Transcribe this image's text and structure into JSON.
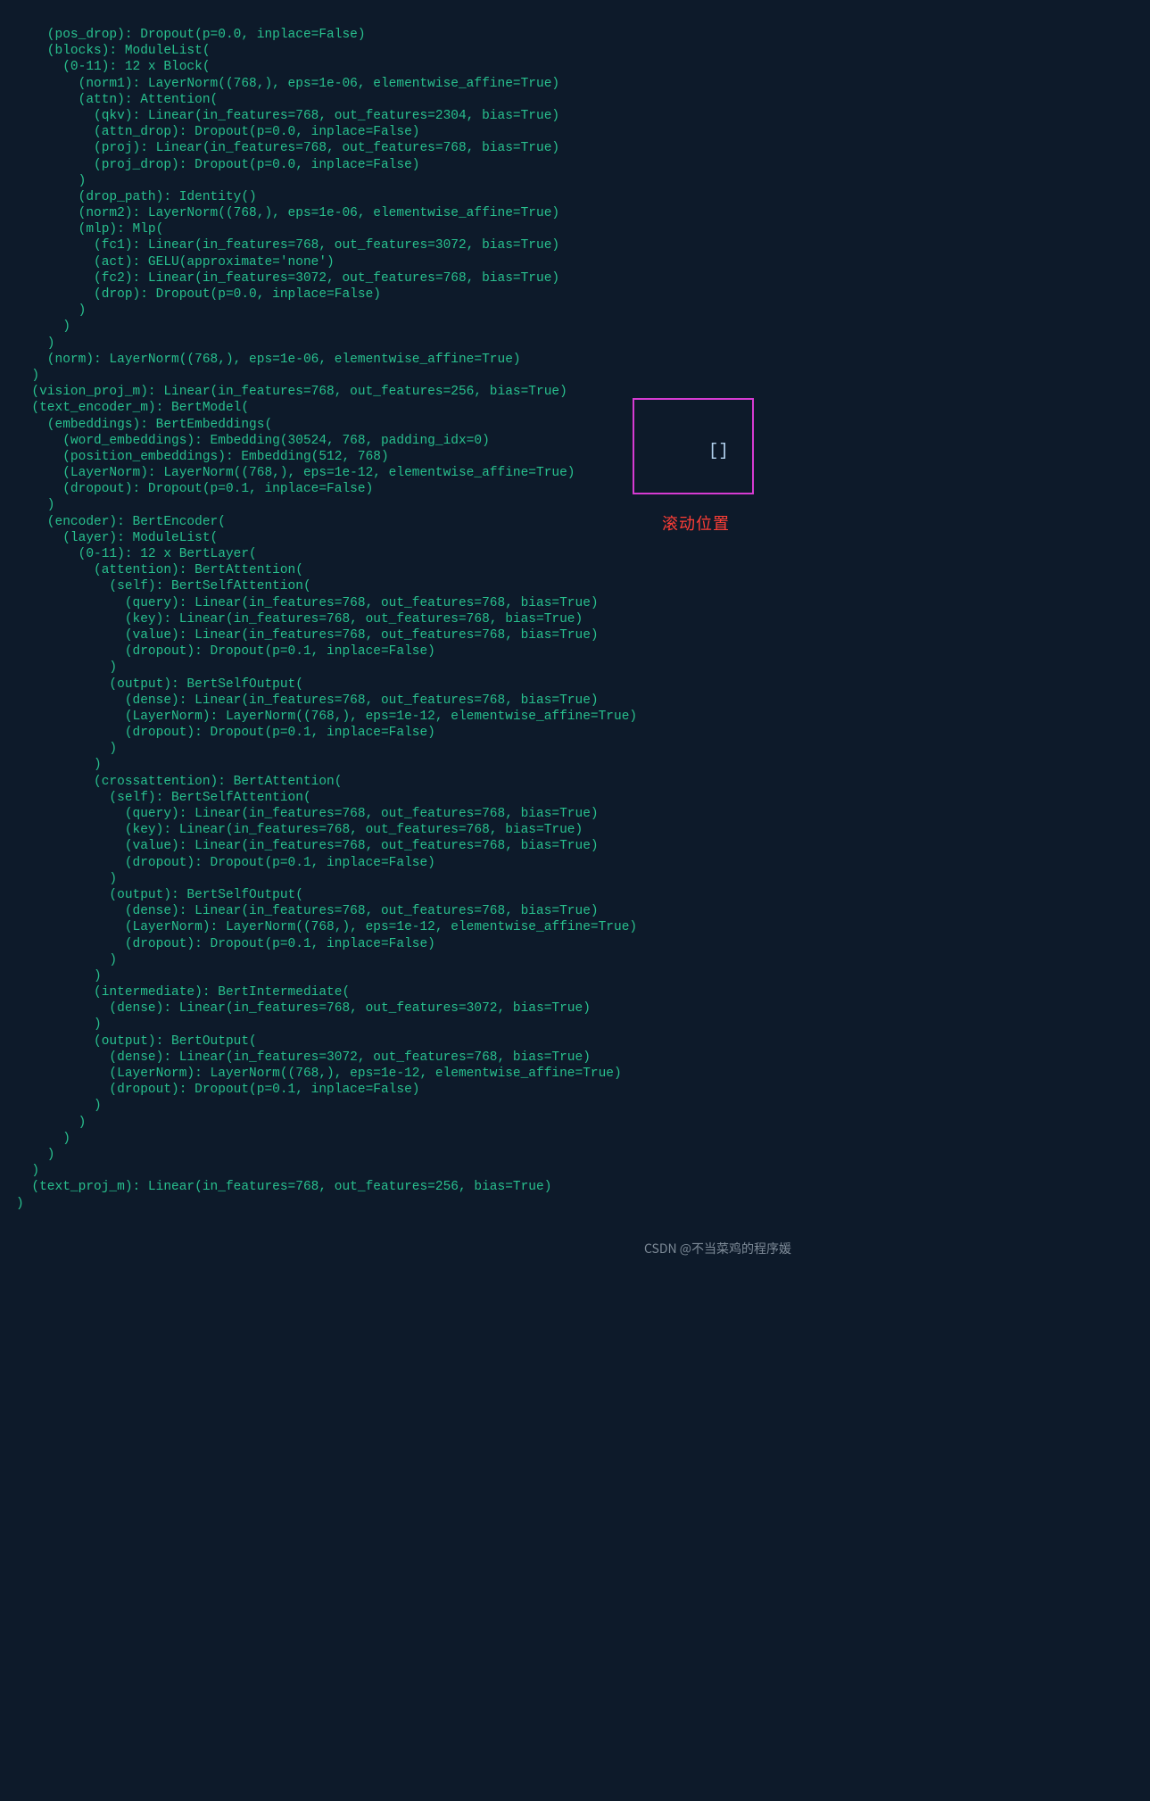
{
  "lines": [
    "    (pos_drop): Dropout(p=0.0, inplace=False)",
    "    (blocks): ModuleList(",
    "      (0-11): 12 x Block(",
    "        (norm1): LayerNorm((768,), eps=1e-06, elementwise_affine=True)",
    "        (attn): Attention(",
    "          (qkv): Linear(in_features=768, out_features=2304, bias=True)",
    "          (attn_drop): Dropout(p=0.0, inplace=False)",
    "          (proj): Linear(in_features=768, out_features=768, bias=True)",
    "          (proj_drop): Dropout(p=0.0, inplace=False)",
    "        )",
    "        (drop_path): Identity()",
    "        (norm2): LayerNorm((768,), eps=1e-06, elementwise_affine=True)",
    "        (mlp): Mlp(",
    "          (fc1): Linear(in_features=768, out_features=3072, bias=True)",
    "          (act): GELU(approximate='none')",
    "          (fc2): Linear(in_features=3072, out_features=768, bias=True)",
    "          (drop): Dropout(p=0.0, inplace=False)",
    "        )",
    "      )",
    "    )",
    "    (norm): LayerNorm((768,), eps=1e-06, elementwise_affine=True)",
    "  )",
    "  (vision_proj_m): Linear(in_features=768, out_features=256, bias=True)",
    "  (text_encoder_m): BertModel(",
    "    (embeddings): BertEmbeddings(",
    "      (word_embeddings): Embedding(30524, 768, padding_idx=0)",
    "      (position_embeddings): Embedding(512, 768)",
    "      (LayerNorm): LayerNorm((768,), eps=1e-12, elementwise_affine=True)",
    "      (dropout): Dropout(p=0.1, inplace=False)",
    "    )",
    "    (encoder): BertEncoder(",
    "      (layer): ModuleList(",
    "        (0-11): 12 x BertLayer(",
    "          (attention): BertAttention(",
    "            (self): BertSelfAttention(",
    "              (query): Linear(in_features=768, out_features=768, bias=True)",
    "              (key): Linear(in_features=768, out_features=768, bias=True)",
    "              (value): Linear(in_features=768, out_features=768, bias=True)",
    "              (dropout): Dropout(p=0.1, inplace=False)",
    "            )",
    "            (output): BertSelfOutput(",
    "              (dense): Linear(in_features=768, out_features=768, bias=True)",
    "              (LayerNorm): LayerNorm((768,), eps=1e-12, elementwise_affine=True)",
    "              (dropout): Dropout(p=0.1, inplace=False)",
    "            )",
    "          )",
    "          (crossattention): BertAttention(",
    "            (self): BertSelfAttention(",
    "              (query): Linear(in_features=768, out_features=768, bias=True)",
    "              (key): Linear(in_features=768, out_features=768, bias=True)",
    "              (value): Linear(in_features=768, out_features=768, bias=True)",
    "              (dropout): Dropout(p=0.1, inplace=False)",
    "            )",
    "            (output): BertSelfOutput(",
    "              (dense): Linear(in_features=768, out_features=768, bias=True)",
    "              (LayerNorm): LayerNorm((768,), eps=1e-12, elementwise_affine=True)",
    "              (dropout): Dropout(p=0.1, inplace=False)",
    "            )",
    "          )",
    "          (intermediate): BertIntermediate(",
    "            (dense): Linear(in_features=768, out_features=3072, bias=True)",
    "          )",
    "          (output): BertOutput(",
    "            (dense): Linear(in_features=3072, out_features=768, bias=True)",
    "            (LayerNorm): LayerNorm((768,), eps=1e-12, elementwise_affine=True)",
    "            (dropout): Dropout(p=0.1, inplace=False)",
    "          )",
    "        )",
    "      )",
    "    )",
    "  )",
    "  (text_proj_m): Linear(in_features=768, out_features=256, bias=True)",
    ")"
  ],
  "annotation": {
    "box_brace": "[]",
    "label": "滚动位置"
  },
  "watermark": "CSDN @不当菜鸡的程序媛"
}
